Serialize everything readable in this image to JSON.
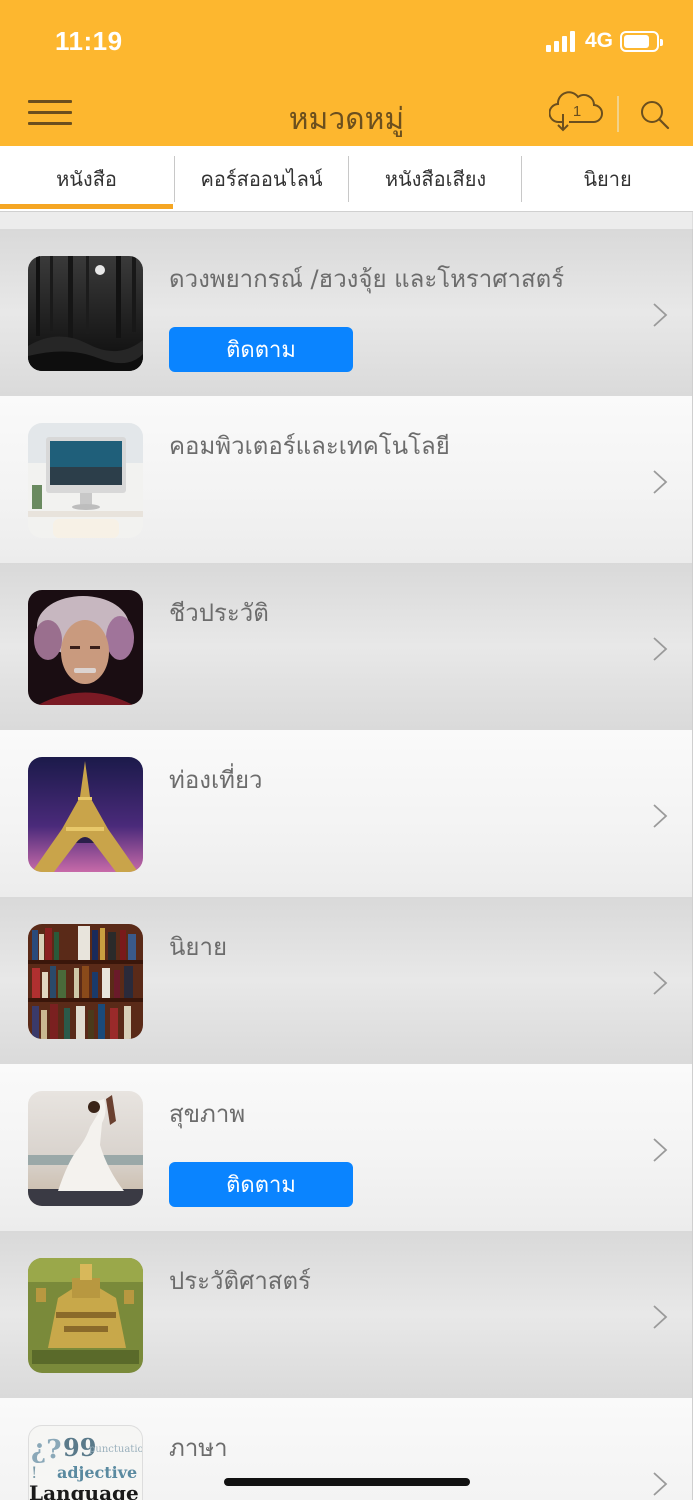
{
  "status_bar": {
    "time": "11:19",
    "network": "4G",
    "battery_level": 0.8
  },
  "header": {
    "title": "หมวดหมู่",
    "download_count": "1",
    "colors": {
      "bar": "#FDB72F"
    }
  },
  "tabs": [
    {
      "label": "หนังสือ",
      "active": true
    },
    {
      "label": "คอร์สออนไลน์",
      "active": false
    },
    {
      "label": "หนังสือเสียง",
      "active": false
    },
    {
      "label": "นิยาย",
      "active": false
    }
  ],
  "categories": [
    {
      "title": "ดวงพยากรณ์ /ฮวงจุ้ย และโหราศาสตร์",
      "follow_label": "ติดตาม",
      "thumb_icon": "dark-forest-image"
    },
    {
      "title": "คอมพิวเตอร์และเทคโนโลยี",
      "thumb_icon": "computer-desk-image"
    },
    {
      "title": "ชีวประวัติ",
      "thumb_icon": "portrait-image"
    },
    {
      "title": "ท่องเที่ยว",
      "thumb_icon": "eiffel-tower-image"
    },
    {
      "title": "นิยาย",
      "thumb_icon": "bookshelf-image"
    },
    {
      "title": "สุขภาพ",
      "follow_label": "ติดตาม",
      "thumb_icon": "yoga-image"
    },
    {
      "title": "ประวัติศาสตร์",
      "thumb_icon": "ancient-ruins-image"
    },
    {
      "title": "ภาษา",
      "thumb_icon": "language-words-image",
      "thumb_words": [
        "punctuation",
        "adjective",
        "Language"
      ]
    }
  ],
  "colors": {
    "follow_button": "#0A84FF",
    "tab_underline": "#F5A623"
  }
}
